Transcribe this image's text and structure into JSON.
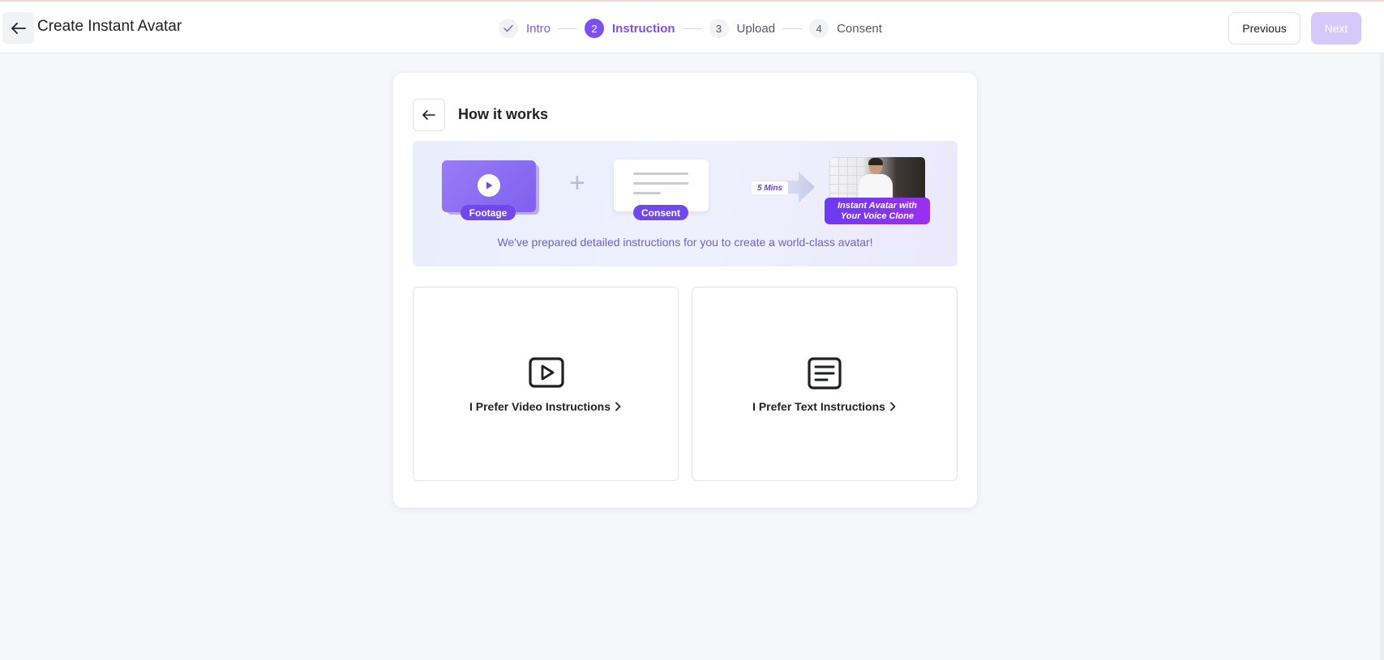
{
  "header": {
    "title": "Create Instant Avatar",
    "previous_label": "Previous",
    "next_label": "Next"
  },
  "stepper": {
    "steps": [
      {
        "number": "1",
        "label": "Intro",
        "state": "done"
      },
      {
        "number": "2",
        "label": "Instruction",
        "state": "active"
      },
      {
        "number": "3",
        "label": "Upload",
        "state": "pending"
      },
      {
        "number": "4",
        "label": "Consent",
        "state": "pending"
      }
    ]
  },
  "card": {
    "title": "How it works",
    "banner": {
      "footage_label": "Footage",
      "consent_label": "Consent",
      "duration_label": "5 Mins",
      "result_label_line1": "Instant Avatar with",
      "result_label_line2": "Your Voice Clone",
      "caption": "We've prepared detailed instructions for you to create a world-class avatar!"
    },
    "options": [
      {
        "label": "I Prefer Video Instructions",
        "icon": "video-play-icon"
      },
      {
        "label": "I Prefer Text Instructions",
        "icon": "text-document-icon"
      }
    ]
  },
  "colors": {
    "accent": "#7b4ff2",
    "next_disabled": "#d7c8fb",
    "background": "#f6f7f9"
  }
}
